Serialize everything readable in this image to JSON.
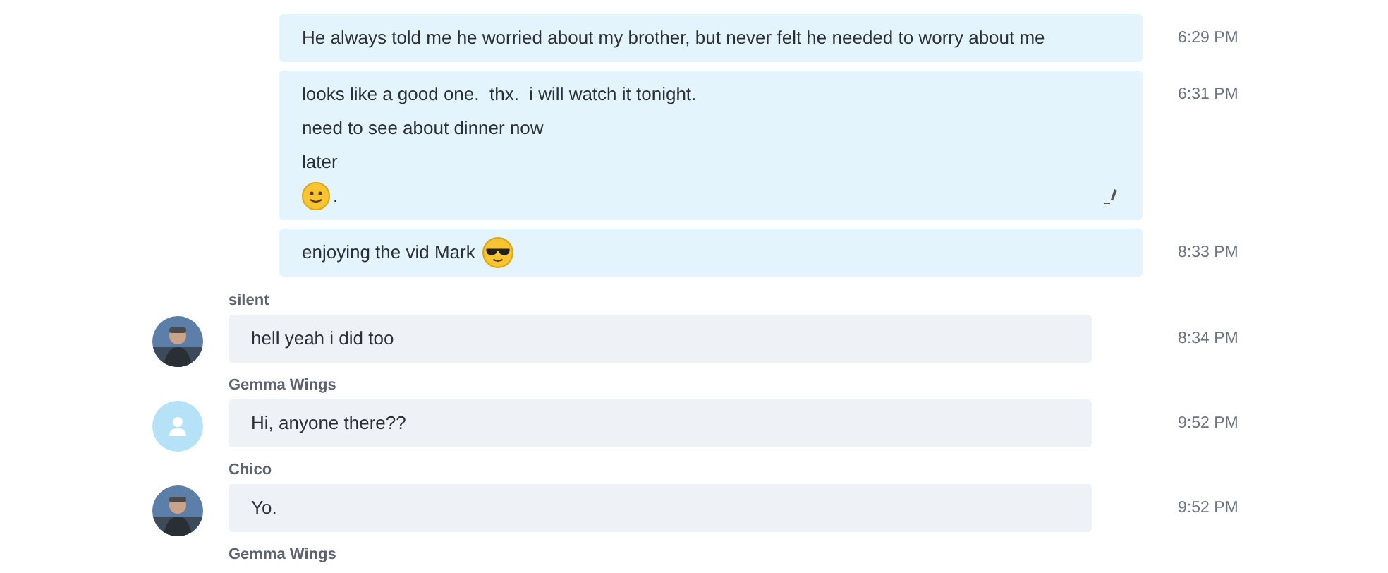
{
  "messages": [
    {
      "kind": "outgoing",
      "time": "6:29 PM",
      "edited": false,
      "lines": [
        {
          "kind": "plain",
          "text": "He always told me he worried about my brother, but never felt he needed to worry about me"
        }
      ]
    },
    {
      "kind": "outgoing",
      "time": "6:31 PM",
      "edited": true,
      "lines": [
        {
          "kind": "plain",
          "text": "looks like a good one.  thx.  i will watch it tonight."
        },
        {
          "kind": "plain",
          "text": "need to see about dinner now"
        },
        {
          "kind": "plain",
          "text": "later"
        },
        {
          "kind": "smile_first",
          "text": "."
        }
      ]
    },
    {
      "kind": "outgoing",
      "time": "8:33 PM",
      "edited": false,
      "lines": [
        {
          "kind": "sunglasses_last",
          "text": "enjoying the vid Mark"
        }
      ]
    },
    {
      "kind": "incoming",
      "sender": "silent",
      "time": "8:34 PM",
      "lines": [
        {
          "kind": "plain",
          "text": "hell yeah i did too"
        }
      ]
    },
    {
      "kind": "incoming",
      "sender": "Gemma Wings",
      "avatar": {
        "kind": "placeholder"
      },
      "time": "9:52 PM",
      "lines": [
        {
          "kind": "plain",
          "text": "Hi, anyone there??"
        }
      ]
    },
    {
      "kind": "incoming",
      "sender": "Chico",
      "time": "9:52 PM",
      "lines": [
        {
          "kind": "plain",
          "text": "Yo."
        }
      ]
    },
    {
      "kind": "sender_only",
      "sender": "Gemma Wings"
    }
  ]
}
